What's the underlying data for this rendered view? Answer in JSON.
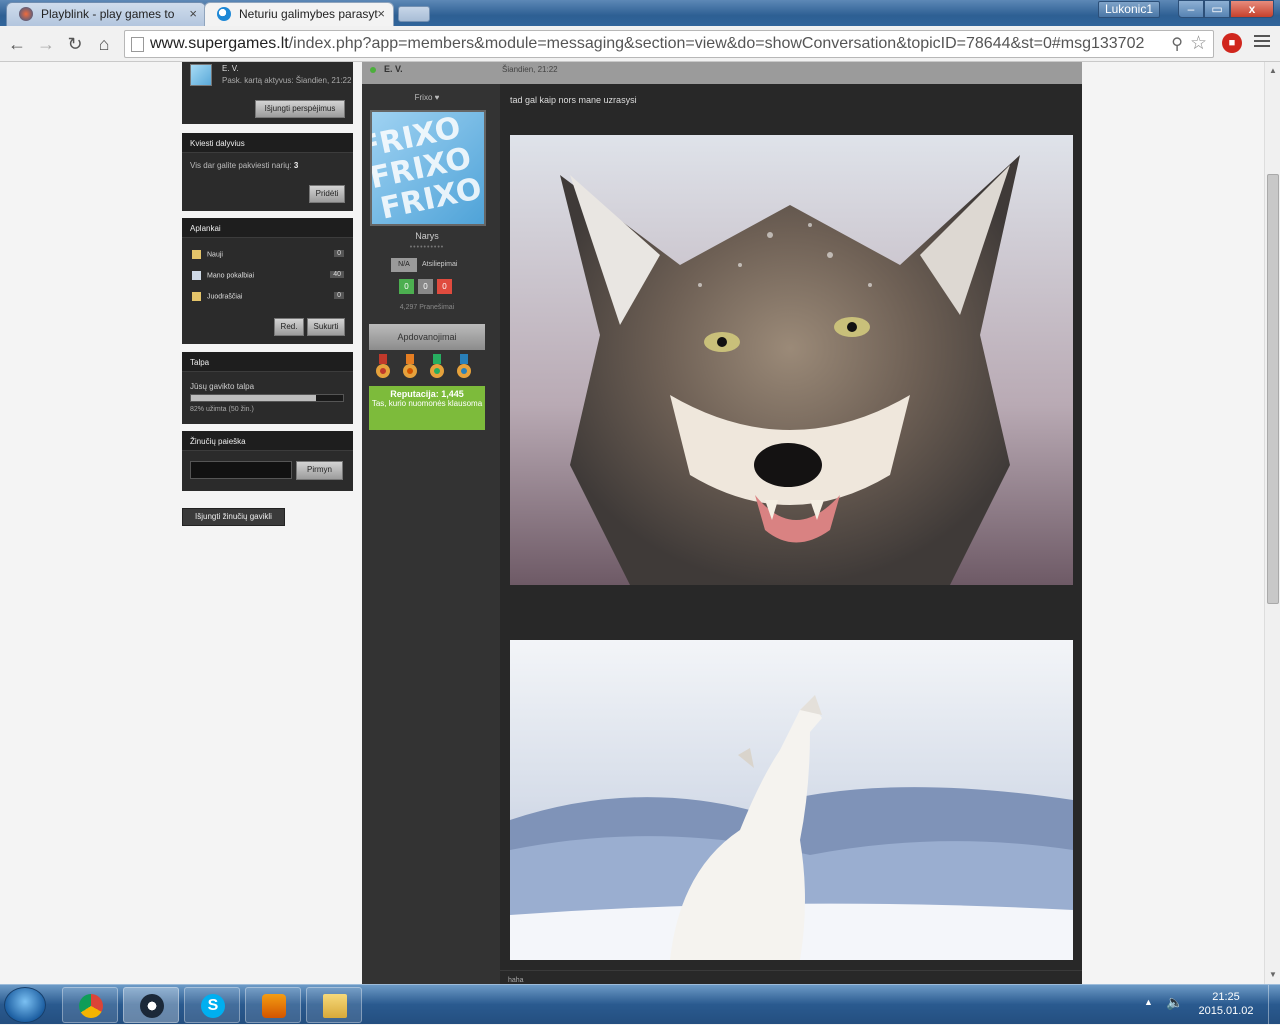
{
  "browser": {
    "tabs": [
      {
        "title": "Playblink - play games to",
        "active": false
      },
      {
        "title": "Neturiu galimybes parasyt",
        "active": true
      }
    ],
    "close_glyph": "×",
    "user_badge": "Lukonic1",
    "window_buttons": {
      "minimize": "–",
      "maximize": "▭",
      "close": "x"
    },
    "url_host": "www.supergames.lt",
    "url_path": "/index.php?app=members&module=messaging&section=view&do=showConversation&topicID=78644&st=0#msg133702",
    "nav_glyphs": {
      "back": "←",
      "forward": "→",
      "reload": "↻",
      "home": "⌂"
    }
  },
  "sidebar": {
    "user_box": {
      "name": "E. V.",
      "last_active": "Pask. kartą aktyvus: Šiandien, 21:22",
      "notify_button": "Išjungti perspėjimus"
    },
    "invite": {
      "title": "Kviesti dalyvius",
      "text_prefix": "Vis dar galite pakviesti narių:",
      "count": "3",
      "add_button": "Pridėti"
    },
    "folders": {
      "title": "Aplankai",
      "items": [
        {
          "label": "Nauji",
          "count": "0"
        },
        {
          "label": "Mano pokalbiai",
          "count": "40"
        },
        {
          "label": "Juodraščiai",
          "count": "0"
        }
      ],
      "edit_button": "Red.",
      "create_button": "Sukurti"
    },
    "storage": {
      "title": "Talpa",
      "label": "Jūsų gavikto talpa",
      "used_percent": 82,
      "used_text": "82% užimta (50 žin.)"
    },
    "search": {
      "title": "Žinučių paieška",
      "input_value": "",
      "button": "Pirmyn"
    },
    "disable_inbox_button": "Išjungti žinučių gavikli"
  },
  "post": {
    "author": "E. V.",
    "date": "Šiandien, 21:22",
    "text": "tad gal kaip nors mane uzrasysi",
    "footer_text": "haha",
    "author_panel": {
      "status": "Frixo ♥",
      "role": "Narys",
      "pips": "••••••••••",
      "rep_badge": "N/A",
      "reviews_label": "Atsiliepimai",
      "review_counts": [
        "0",
        "0",
        "0"
      ],
      "posts": "4,297 Pranešimai",
      "awards_button": "Apdovanojimai",
      "reputation_title": "Reputacija: 1,445",
      "reputation_subtitle": "Tas, kurio nuomonės klausoma"
    },
    "images": [
      {
        "subject": "snarling wolf"
      },
      {
        "subject": "howling white wolf"
      }
    ]
  },
  "taskbar": {
    "apps": [
      "chrome",
      "steam",
      "skype",
      "media-player",
      "file-explorer"
    ],
    "time": "21:25",
    "date": "2015.01.02"
  }
}
